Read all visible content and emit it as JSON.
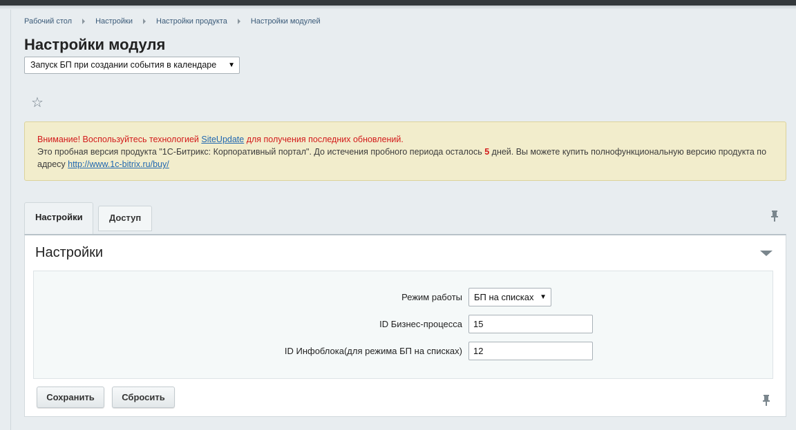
{
  "breadcrumb": [
    "Рабочий стол",
    "Настройки",
    "Настройки продукта",
    "Настройки модулей"
  ],
  "page_title": "Настройки модуля",
  "module_select": {
    "value": "Запуск БП при создании события в календаре"
  },
  "notice": {
    "warning_prefix": "Внимание! Воспользуйтесь технологией ",
    "warning_link": "SiteUpdate",
    "warning_suffix": " для получения последних обновлений.",
    "trial_text_1": "Это пробная версия продукта \"1С-Битрикс: Корпоративный портал\". До истечения пробного периода осталось ",
    "trial_days": "5",
    "trial_text_2": " дней. Вы можете купить полнофункциональную версию продукта по адресу ",
    "buy_link": "http://www.1c-bitrix.ru/buy/"
  },
  "tabs": [
    {
      "label": "Настройки",
      "active": true
    },
    {
      "label": "Доступ",
      "active": false
    }
  ],
  "panel": {
    "title": "Настройки",
    "fields": {
      "mode": {
        "label": "Режим работы",
        "value": "БП на списках"
      },
      "bp_id": {
        "label": "ID Бизнес-процесса",
        "value": "15"
      },
      "iblock_id": {
        "label": "ID Инфоблока(для режима БП на списках)",
        "value": "12"
      }
    }
  },
  "buttons": {
    "save": "Сохранить",
    "reset": "Сбросить"
  },
  "icons": {
    "favorite": "star-icon",
    "pin": "pin-icon",
    "collapse": "triangle-down-icon",
    "select_arrow": "▼"
  },
  "colors": {
    "warning_text": "#d21a1a",
    "link": "#2067b0",
    "notice_bg": "#f2edcc"
  }
}
